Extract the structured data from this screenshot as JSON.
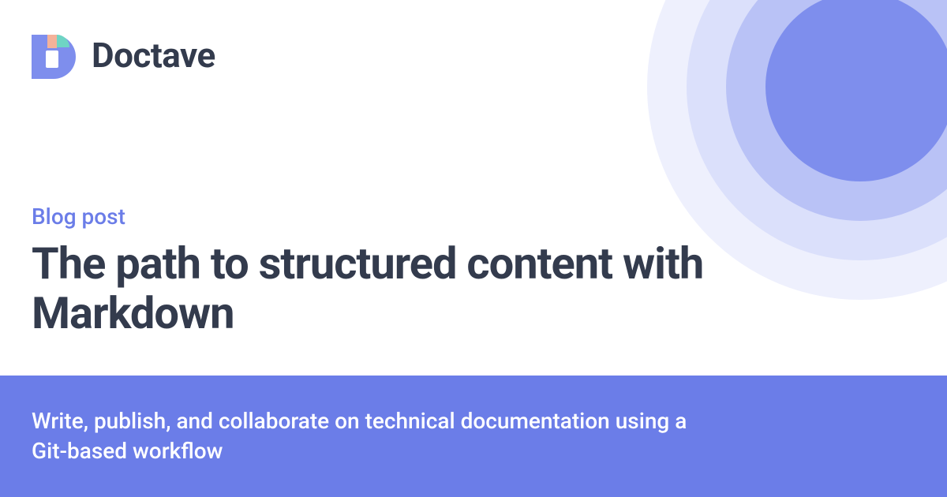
{
  "brand": {
    "name": "Doctave"
  },
  "post": {
    "category": "Blog post",
    "title": "The path to structured content with Markdown"
  },
  "footer": {
    "tagline": "Write, publish, and collaborate on technical documentation using a Git-based workflow"
  },
  "colors": {
    "accent": "#6b7de8",
    "text": "#333b4d",
    "logo_peach": "#f4b29a",
    "logo_teal": "#6fd4c4"
  }
}
